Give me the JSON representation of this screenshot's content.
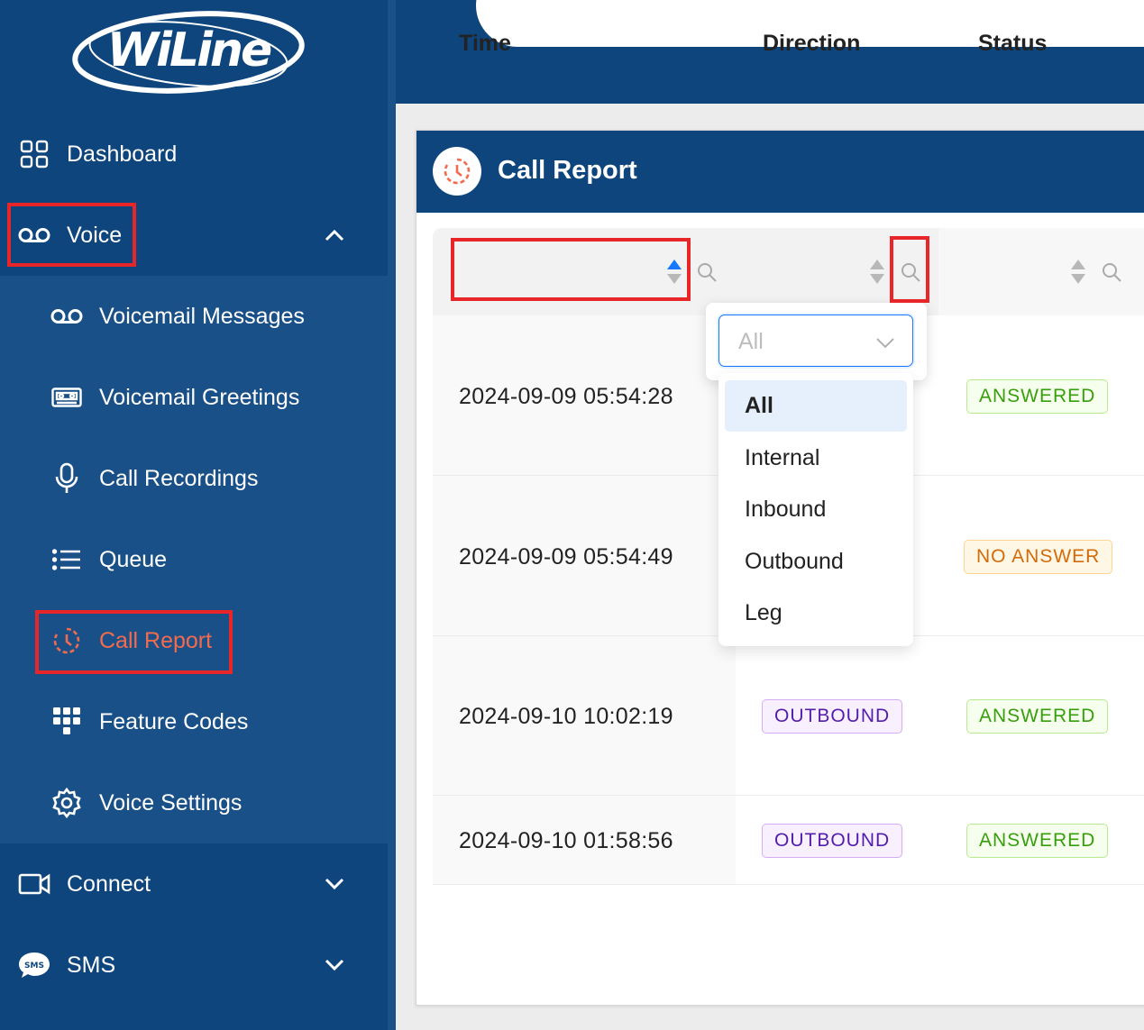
{
  "brand": {
    "logo_text": "WiLine"
  },
  "sidebar": {
    "items": [
      {
        "label": "Dashboard",
        "icon": "dashboard-grid-icon"
      },
      {
        "label": "Voice",
        "icon": "voicemail-icon",
        "expanded": true
      },
      {
        "label": "Connect",
        "icon": "video-camera-icon"
      },
      {
        "label": "SMS",
        "icon": "sms-bubble-icon"
      }
    ],
    "voice_submenu": [
      {
        "label": "Voicemail Messages",
        "icon": "voicemail-icon"
      },
      {
        "label": "Voicemail Greetings",
        "icon": "cassette-tape-icon"
      },
      {
        "label": "Call Recordings",
        "icon": "microphone-icon"
      },
      {
        "label": "Queue",
        "icon": "list-icon"
      },
      {
        "label": "Call Report",
        "icon": "history-clock-icon",
        "active": true
      },
      {
        "label": "Feature Codes",
        "icon": "keypad-icon"
      },
      {
        "label": "Voice Settings",
        "icon": "gear-icon"
      }
    ]
  },
  "card": {
    "title": "Call Report",
    "icon": "history-clock-icon"
  },
  "table": {
    "columns": [
      {
        "label": "Time",
        "sort": "ascending"
      },
      {
        "label": "Direction"
      },
      {
        "label": "Status"
      }
    ],
    "rows": [
      {
        "time": "2024-09-09 05:54:28",
        "direction": "",
        "status": "ANSWERED"
      },
      {
        "time": "2024-09-09 05:54:49",
        "direction": "",
        "status": "NO ANSWER"
      },
      {
        "time": "2024-09-10 10:02:19",
        "direction": "OUTBOUND",
        "status": "ANSWERED"
      },
      {
        "time": "2024-09-10 01:58:56",
        "direction": "OUTBOUND",
        "status": "ANSWERED"
      }
    ]
  },
  "direction_filter": {
    "placeholder": "All",
    "options": [
      "All",
      "Internal",
      "Inbound",
      "Outbound",
      "Leg"
    ],
    "selected": "All"
  },
  "colors": {
    "sidebar_bg": "#0e457d",
    "submenu_bg": "#1a5088",
    "accent_active": "#f26b4f",
    "highlight_box": "#e8262a",
    "sort_active": "#1677ff"
  }
}
